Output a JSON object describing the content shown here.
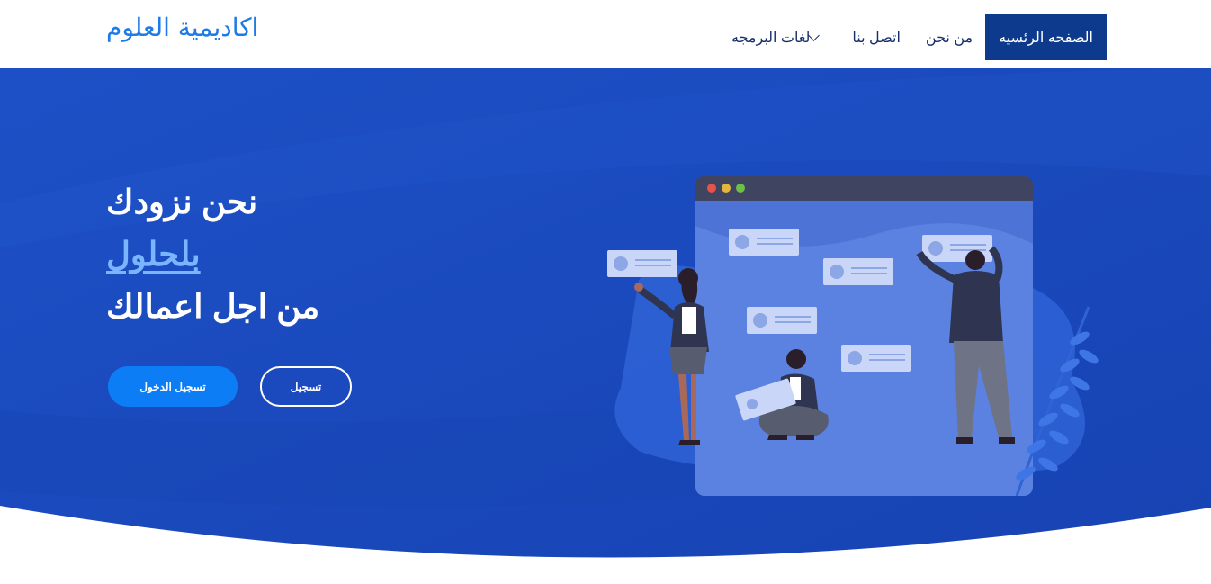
{
  "header": {
    "logo": "اكاديمية العلوم",
    "nav": [
      {
        "label": "الصفحه الرئسيه",
        "active": true
      },
      {
        "label": "من نحن"
      },
      {
        "label": "اتصل بنا"
      },
      {
        "label": "لغات البرمجه",
        "dropdown": true
      }
    ]
  },
  "hero": {
    "line1": "نحن نزودك",
    "line2": "بلحلول",
    "line3": "من اجل اعمالك",
    "login_button": "تسجيل الدخول",
    "register_button": "تسجيل"
  },
  "colors": {
    "hero_blue": "#1a4cc0",
    "active_nav": "#0d3a8c",
    "accent": "#0d7df5",
    "logo": "#1e7be6"
  }
}
